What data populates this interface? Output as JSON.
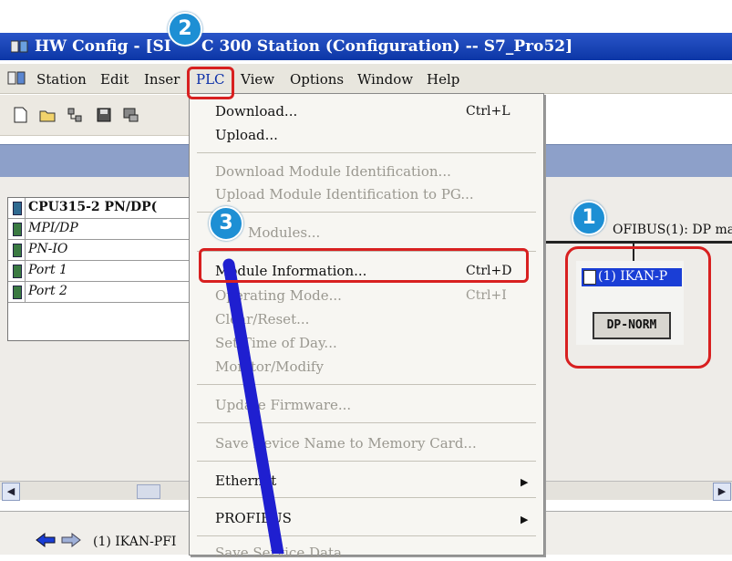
{
  "window": {
    "title": "HW Config - [SIMATIC 300 Station (Configuration) -- S7_Pro52]",
    "title_visible": "HW Config - [SI",
    "title_tail": "C 300 Station (Configuration) -- S7_Pro52]"
  },
  "menubar": {
    "items": [
      "Station",
      "Edit",
      "Inser",
      "PLC",
      "View",
      "Options",
      "Window",
      "Help"
    ]
  },
  "plc_menu": {
    "items": [
      {
        "label": "Download...",
        "shortcut": "Ctrl+L",
        "enabled": true
      },
      {
        "label": "Upload...",
        "shortcut": "",
        "enabled": true
      },
      {
        "label": "Download Module Identification...",
        "shortcut": "",
        "enabled": false
      },
      {
        "label": "Upload Module Identification to PG...",
        "shortcut": "",
        "enabled": false
      },
      {
        "label": "Modules...",
        "shortcut": "",
        "enabled": false
      },
      {
        "label": "Module Information...",
        "shortcut": "Ctrl+D",
        "enabled": true
      },
      {
        "label": "Operating Mode...",
        "shortcut": "Ctrl+I",
        "enabled": false
      },
      {
        "label": "Clear/Reset...",
        "shortcut": "",
        "enabled": false
      },
      {
        "label": "Set Time of Day...",
        "shortcut": "",
        "enabled": false
      },
      {
        "label": "Monitor/Modify",
        "shortcut": "",
        "enabled": false
      },
      {
        "label": "Update Firmware...",
        "shortcut": "",
        "enabled": false
      },
      {
        "label": "Save Device Name to Memory Card...",
        "shortcut": "",
        "enabled": false
      },
      {
        "label": "Ethernet",
        "shortcut": "",
        "enabled": true
      },
      {
        "label": "PROFIBUS",
        "shortcut": "",
        "enabled": true
      },
      {
        "label": "Save Service Data",
        "shortcut": "",
        "enabled": false
      }
    ]
  },
  "rack": {
    "rows": [
      "CPU315-2 PN/DP(",
      "MPI/DP",
      "PN-IO",
      "Port 1",
      "Port 2"
    ]
  },
  "network": {
    "bus_label": "OFIBUS(1): DP ma",
    "slave_title": "(1) IKAN-P",
    "slave_button": "DP-NORM"
  },
  "bottom": {
    "text": "(1)  IKAN-PFI"
  },
  "badges": {
    "one": "1",
    "two": "2",
    "three": "3"
  },
  "colors": {
    "highlight": "#d82020",
    "badge": "#1d8fd4",
    "titlebar": "#0c36a6",
    "annotation_line": "#1f1fd0"
  }
}
